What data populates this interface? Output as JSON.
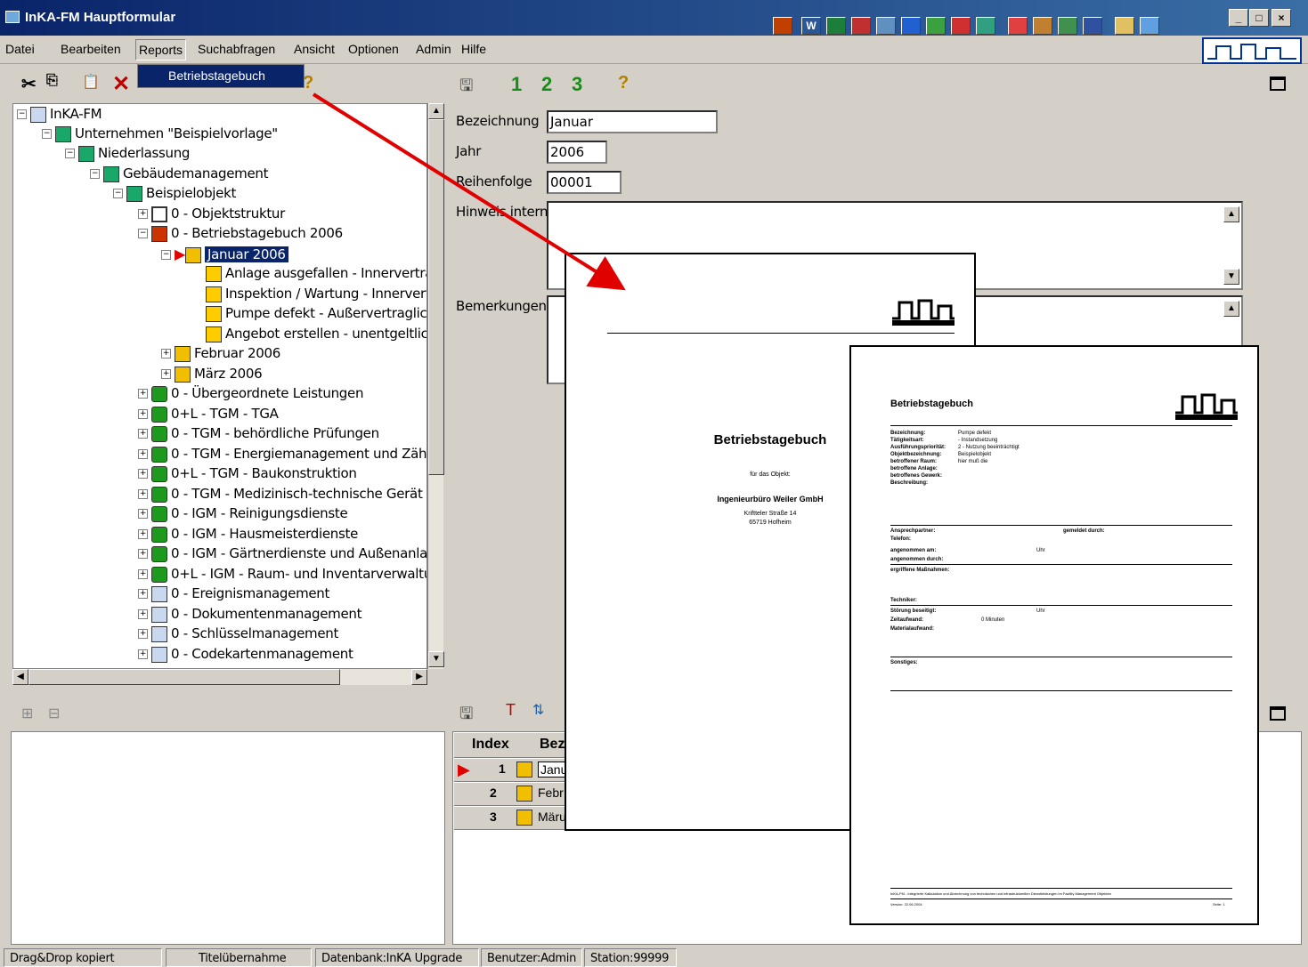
{
  "window": {
    "title": "InKA-FM Hauptformular"
  },
  "menubar": {
    "items": [
      "Datei",
      "Bearbeiten",
      "Reports",
      "Suchabfragen",
      "Ansicht",
      "Optionen",
      "Admin",
      "Hilfe"
    ],
    "dropdown_item": "Betriebstagebuch"
  },
  "titlebar_buttons": [
    "_",
    "□",
    "×"
  ],
  "form_toolbar": {
    "tab1": "1",
    "tab2": "2",
    "tab3": "3"
  },
  "tree": {
    "items": [
      "InKA-FM",
      "Unternehmen \"Beispielvorlage\"",
      "Niederlassung",
      "Gebäudemanagement",
      "Beispielobjekt",
      "0 - Objektstruktur",
      "0 - Betriebstagebuch 2006",
      "Januar 2006",
      "Anlage ausgefallen - Innervertrac",
      "Inspektion / Wartung - Innervert",
      "Pumpe defekt - Außervertraglich",
      "Angebot erstellen - unentgeltlich",
      "Februar 2006",
      "März 2006",
      "0 - Übergeordnete Leistungen",
      "0+L - TGM - TGA",
      "0 - TGM - behördliche Prüfungen",
      "0 - TGM - Energiemanagement und Zäh",
      "0+L - TGM - Baukonstruktion",
      "0 - TGM - Medizinisch-technische Gerät",
      "0 - IGM - Reinigungsdienste",
      "0 - IGM - Hausmeisterdienste",
      "0 - IGM - Gärtnerdienste und Außenanla",
      "0+L - IGM - Raum- und Inventarverwaltu",
      "0 - Ereignismanagement",
      "0 - Dokumentenmanagement",
      "0 - Schlüsselmanagement",
      "0 - Codekartenmanagement"
    ]
  },
  "form": {
    "bezeichnung_label": "Bezeichnung",
    "bezeichnung_value": "Januar",
    "jahr_label": "Jahr",
    "jahr_value": "2006",
    "reihenfolge_label": "Reihenfolge",
    "reihenfolge_value": "00001",
    "hinweis_label": "Hinweis intern",
    "bemerkungen_label": "Bemerkungen"
  },
  "grid": {
    "headers": [
      "Index",
      "Bez"
    ],
    "rows": [
      {
        "index": "1",
        "name": "Janu"
      },
      {
        "index": "2",
        "name": "Febr"
      },
      {
        "index": "3",
        "name": "Märu"
      }
    ]
  },
  "statusbar": {
    "cells": [
      "Drag&Drop kopiert",
      "Titelübernahme",
      "Datenbank:InKA Upgrade",
      "Benutzer:Admin",
      "Station:99999"
    ]
  },
  "report_cover": {
    "title": "Betriebstagebuch",
    "subtitle": "für das Objekt:",
    "company": "Ingenieurbüro Weiler GmbH",
    "street": "Kriftteler Straße 14",
    "city": "65719 Hofheim"
  },
  "report_detail": {
    "title": "Betriebstagebuch",
    "fields": [
      {
        "label": "Bezeichnung:",
        "value": "Pumpe defekt"
      },
      {
        "label": "Tätigkeitsart:",
        "value": "- Instandsetzung"
      },
      {
        "label": "Ausführungspriorität:",
        "value": "2 - Nutzung beeinträchtigt"
      },
      {
        "label": "Objektbezeichnung:",
        "value": "Beispielobjekt"
      },
      {
        "label": "betroffener Raum:",
        "value": "hier muß die"
      },
      {
        "label": "betroffene Anlage:",
        "value": ""
      },
      {
        "label": "betroffenes Gewerk:",
        "value": ""
      },
      {
        "label": "Beschreibung:",
        "value": ""
      }
    ],
    "ansprechpartner": "Ansprechpartner:",
    "gemeldet": "gemeldet durch:",
    "telefon": "Telefon:",
    "angenommen_am": "angenommen am:",
    "uhr": "Uhr",
    "angenommen_durch": "angenommen durch:",
    "massnahmen": "ergriffene Maßnahmen:",
    "techniker": "Techniker:",
    "stoerung": "Störung beseitigt:",
    "zeitaufwand": "Zeitaufwand:",
    "zeit_value": "0 Minuten",
    "material": "Materialaufwand:",
    "sonstiges": "Sonstiges:",
    "footer": "InKA-FM - Integrierte Kalkulation und Abrechnung von technischen und infrastrukturellen Dienstleistungen im Facility Management Objekten",
    "version": "Version: 22.06.2004",
    "page": "Seite: 1"
  },
  "colors": {
    "titlebar": "#0a246a",
    "selection": "#0a246a",
    "arrow": "#e00000",
    "window_bg": "#d4d0c8"
  }
}
